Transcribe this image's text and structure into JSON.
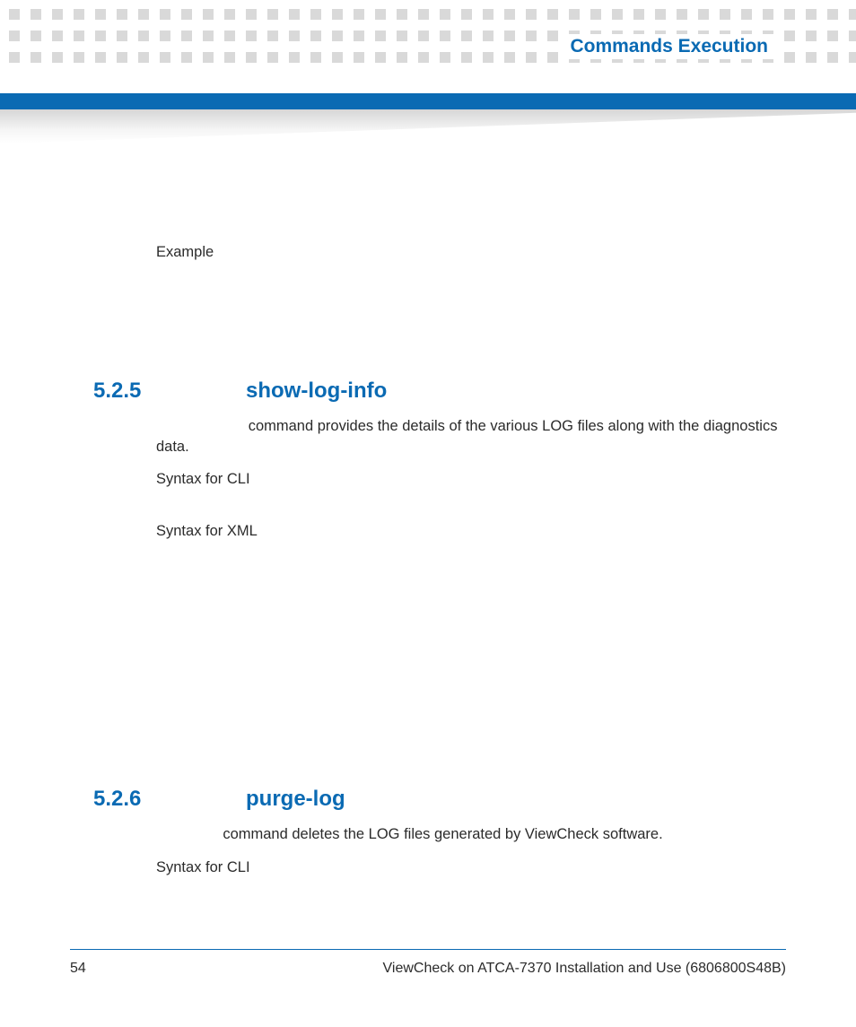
{
  "header": {
    "title": "Commands Execution"
  },
  "body": {
    "example_label": "Example"
  },
  "sections": [
    {
      "number": "5.2.5",
      "title": "show-log-info",
      "desc_tail": "command provides the details of the various LOG files along with the diagnostics data.",
      "syntax_cli_label": "Syntax for CLI",
      "syntax_xml_label": "Syntax for XML"
    },
    {
      "number": "5.2.6",
      "title": "purge-log",
      "desc_tail": "command deletes the LOG files generated by ViewCheck software.",
      "syntax_cli_label": "Syntax for CLI"
    }
  ],
  "footer": {
    "page_number": "54",
    "doc_title": "ViewCheck on ATCA-7370 Installation and Use (6806800S48B)"
  }
}
